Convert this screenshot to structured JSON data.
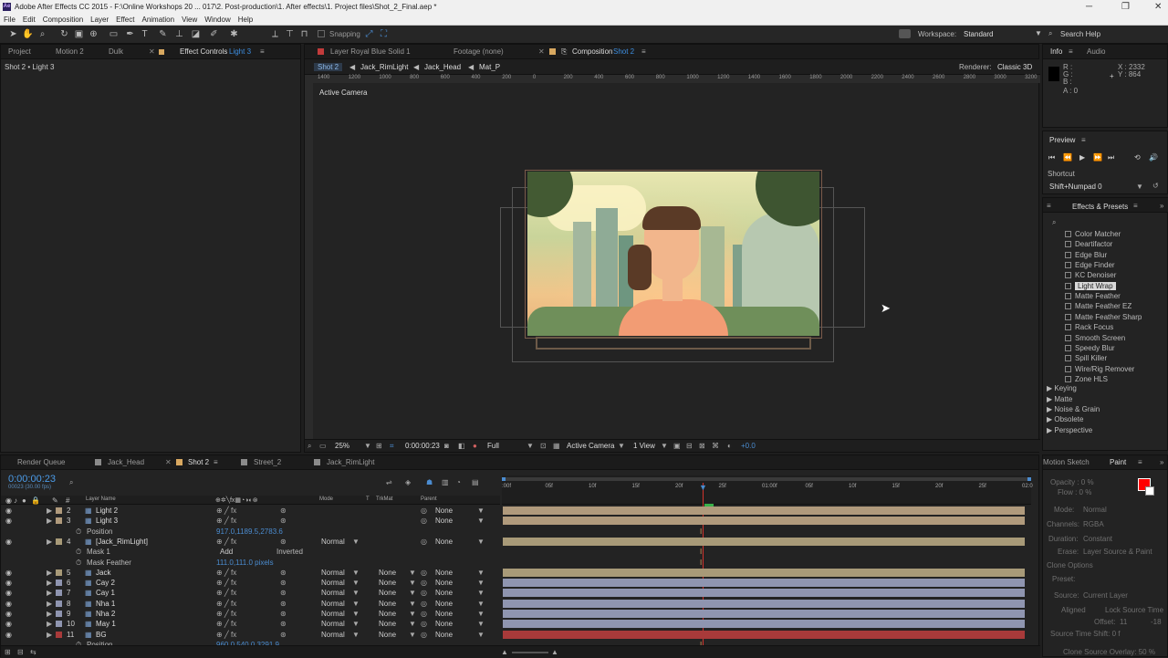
{
  "app": {
    "title": "Adobe After Effects CC 2015 - F:\\Online Workshops 20 ... 017\\2. Post-production\\1. After effects\\1. Project files\\Shot_2_Final.aep *",
    "menu": [
      "File",
      "Edit",
      "Composition",
      "Layer",
      "Effect",
      "Animation",
      "View",
      "Window",
      "Help"
    ]
  },
  "toolbar": {
    "snapping_label": "Snapping",
    "workspace_label": "Workspace:",
    "workspace_value": "Standard",
    "search_help": "Search Help"
  },
  "left_panel": {
    "tabs": [
      "Project",
      "Motion 2",
      "Dulk",
      "Effect Controls"
    ],
    "effect_controls_target": "Light 3",
    "subtitle": "Shot 2 • Light 3"
  },
  "viewer": {
    "tabs": [
      "Layer Royal Blue Solid 1",
      "Footage (none)",
      "Composition"
    ],
    "comp_name": "Shot 2",
    "crumbs": [
      "Shot 2",
      "Jack_RimLight",
      "Jack_Head",
      "Mat_P"
    ],
    "renderer_label": "Renderer:",
    "renderer_value": "Classic 3D",
    "camera_label": "Active Camera",
    "ruler_labels": [
      "1400",
      "1200",
      "1000",
      "800",
      "600",
      "400",
      "200",
      "0",
      "200",
      "400",
      "600",
      "800",
      "1000",
      "1200",
      "1400",
      "1600",
      "1800",
      "2000",
      "2200",
      "2400",
      "2600",
      "2800",
      "3000",
      "3200"
    ],
    "footer": {
      "zoom": "25%",
      "timecode": "0:00:00:23",
      "resolution": "Full",
      "camera": "Active Camera",
      "views": "1 View",
      "exposure": "+0.0"
    }
  },
  "info": {
    "tabs": [
      "Info",
      "Audio"
    ],
    "r": "R :",
    "g": "G :",
    "b": "B :",
    "a": "A : 0",
    "x": "X : 2332",
    "y": "Y : 864"
  },
  "preview": {
    "title": "Preview",
    "shortcut_label": "Shortcut",
    "shortcut_value": "Shift+Numpad 0"
  },
  "effects": {
    "title": "Effects & Presets",
    "items": [
      "Color Matcher",
      "Deartifactor",
      "Edge Blur",
      "Edge Finder",
      "KC Denoiser",
      "Light Wrap",
      "Matte Feather",
      "Matte Feather EZ",
      "Matte Feather Sharp",
      "Rack Focus",
      "Smooth Screen",
      "Speedy Blur",
      "Spill Killer",
      "Wire/Rig Remover",
      "Zone HLS"
    ],
    "selected": "Light Wrap",
    "categories": [
      "Keying",
      "Matte",
      "Noise & Grain",
      "Obsolete",
      "Perspective"
    ]
  },
  "timeline": {
    "tabs": [
      "Render Queue",
      "Jack_Head",
      "Shot 2",
      "Street_2",
      "Jack_RimLight"
    ],
    "active_tab": "Shot 2",
    "timecode": "0:00:00:23",
    "frames": "00023 (30.00 fps)",
    "columns": {
      "layer_name": "Layer Name",
      "mode": "Mode",
      "t": "T",
      "trkmat": "TrkMat",
      "parent": "Parent"
    },
    "ruler_labels": [
      ":00f",
      "05f",
      "10f",
      "15f",
      "20f",
      "25f",
      "01:00f",
      "05f",
      "10f",
      "15f",
      "20f",
      "25f",
      "02:0"
    ],
    "rows": [
      {
        "num": "2",
        "name": "Light 2",
        "mode": "",
        "trk": "",
        "parent": "None",
        "color": "#b09a7c"
      },
      {
        "num": "3",
        "name": "Light 3",
        "mode": "",
        "trk": "",
        "parent": "None",
        "color": "#b09a7c"
      },
      {
        "num": "",
        "name": "Position",
        "value": "917.0,1189.5,2783.6"
      },
      {
        "num": "4",
        "name": "[Jack_RimLight]",
        "mode": "Normal",
        "trk": "",
        "parent": "None",
        "color": "#a89a78"
      },
      {
        "num": "",
        "name": "Mask 1",
        "mode": "Add",
        "extra": "Inverted"
      },
      {
        "num": "",
        "name": "Mask Feather",
        "value": "111.0,111.0 pixels"
      },
      {
        "num": "5",
        "name": "Jack",
        "mode": "Normal",
        "trk": "None",
        "parent": "None",
        "color": "#a89a78"
      },
      {
        "num": "6",
        "name": "Cay 2",
        "mode": "Normal",
        "trk": "None",
        "parent": "None",
        "color": "#8f95b0"
      },
      {
        "num": "7",
        "name": "Cay 1",
        "mode": "Normal",
        "trk": "None",
        "parent": "None",
        "color": "#8f95b0"
      },
      {
        "num": "8",
        "name": "Nha 1",
        "mode": "Normal",
        "trk": "None",
        "parent": "None",
        "color": "#8f95b0"
      },
      {
        "num": "9",
        "name": "Nha 2",
        "mode": "Normal",
        "trk": "None",
        "parent": "None",
        "color": "#8f95b0"
      },
      {
        "num": "10",
        "name": "May 1",
        "mode": "Normal",
        "trk": "None",
        "parent": "None",
        "color": "#8f95b0"
      },
      {
        "num": "11",
        "name": "BG",
        "mode": "Normal",
        "trk": "None",
        "parent": "None",
        "color": "#a83a3a"
      },
      {
        "num": "",
        "name": "Position",
        "value": "960.0,540.0,3291.9"
      }
    ]
  },
  "paint": {
    "tabs": [
      "Motion Sketch",
      "Paint"
    ],
    "opacity": "Opacity : 0 %",
    "flow": "Flow : 0 %",
    "mode": "Mode:",
    "mode_value": "Normal",
    "channels": "Channels:",
    "channels_value": "RGBA",
    "duration": "Duration:",
    "duration_value": "Constant",
    "erase": "Erase:",
    "erase_value": "Layer Source & Paint",
    "clone_options": "Clone Options",
    "preset": "Preset:",
    "source": "Source:",
    "source_value": "Current Layer",
    "aligned": "Aligned",
    "lock_source": "Lock Source Time",
    "offset": "Offset:",
    "offset_x": "11",
    "offset_y": "-18",
    "source_time_shift": "Source Time Shift: 0 f",
    "clone_overlay": "Clone Source Overlay: 50 %",
    "color": "#ff0000"
  }
}
